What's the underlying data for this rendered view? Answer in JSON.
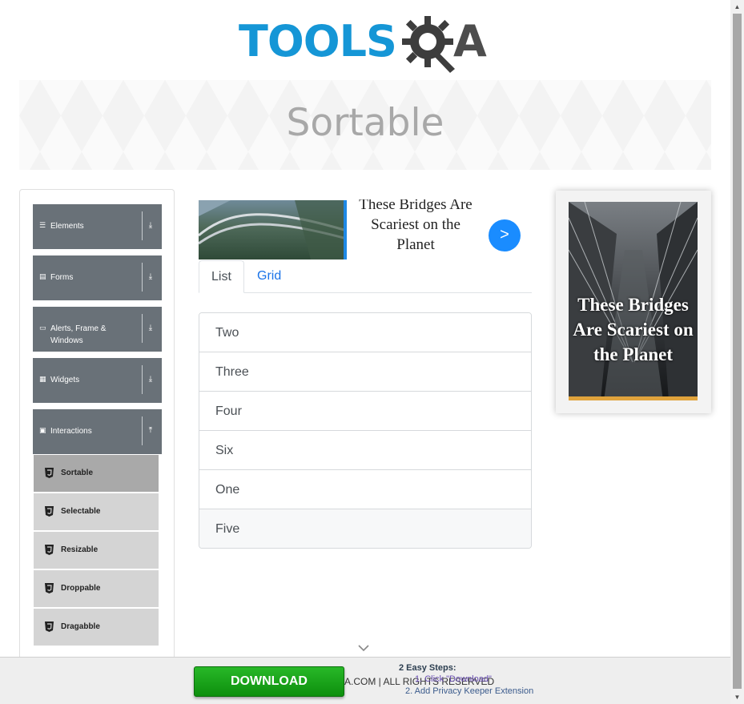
{
  "logo": {
    "left_text": "TOOLS",
    "right_text": "A"
  },
  "banner": {
    "title": "Sortable"
  },
  "sidebar": {
    "groups": [
      {
        "label": "Elements",
        "icon": "menu-icon",
        "arrow": "⤓"
      },
      {
        "label": "Forms",
        "icon": "form-icon",
        "arrow": "⤓"
      },
      {
        "label": "Alerts, Frame & Windows",
        "icon": "window-icon",
        "arrow": "⤓"
      },
      {
        "label": "Widgets",
        "icon": "grid-icon",
        "arrow": "⤓"
      },
      {
        "label": "Interactions",
        "icon": "interactions-icon",
        "arrow": "⤒"
      }
    ],
    "subitems": [
      "Sortable",
      "Selectable",
      "Resizable",
      "Droppable",
      "Dragabble"
    ],
    "active_subitem": "Sortable"
  },
  "ad_top": {
    "text": "These Bridges Are Scariest on the Planet",
    "button": ">"
  },
  "tabs": [
    {
      "label": "List",
      "active": true
    },
    {
      "label": "Grid",
      "active": false
    }
  ],
  "list_items": [
    "Two",
    "Three",
    "Four",
    "Six",
    "One",
    "Five"
  ],
  "ad_right": {
    "text": "These Bridges Are Scariest on the Planet"
  },
  "footer": {
    "copyright": "A.COM | ALL RIGHTS RESERVED",
    "download_button": "DOWNLOAD",
    "steps_title": "2 Easy Steps:",
    "step1": "1. Click \"Download\"",
    "step2": "2. Add Privacy Keeper Extension"
  },
  "colors": {
    "brand_blue": "#1596d6",
    "sidebar_group": "#697178",
    "active_sub": "#a9a9a9",
    "ad_button": "#1a8cff",
    "download_green": "#1aa51a"
  }
}
